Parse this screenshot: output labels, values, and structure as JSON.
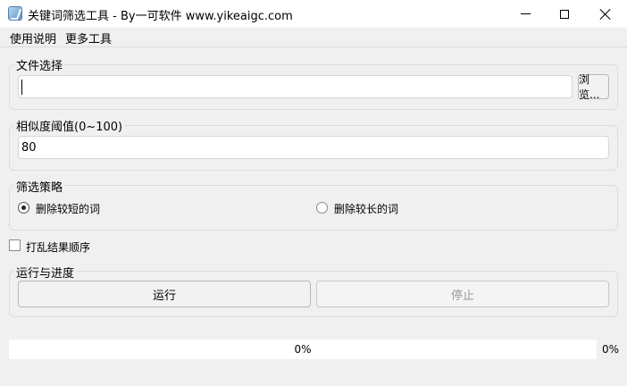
{
  "window": {
    "title": "关键词筛选工具 - By一可软件 www.yikeaigc.com",
    "icon": "app-icon"
  },
  "menu": {
    "items": [
      {
        "label": "使用说明"
      },
      {
        "label": "更多工具"
      }
    ]
  },
  "file_group": {
    "title": "文件选择",
    "path_value": "",
    "browse_label": "浏览..."
  },
  "similarity_group": {
    "title": "相似度阈值(0~100)",
    "value": "80"
  },
  "strategy_group": {
    "title": "筛选策略",
    "options": [
      {
        "label": "删除较短的词",
        "selected": true
      },
      {
        "label": "删除较长的词",
        "selected": false
      }
    ]
  },
  "shuffle_option": {
    "label": "打乱结果顺序",
    "checked": false
  },
  "run_group": {
    "title": "运行与进度",
    "run_label": "运行",
    "stop_label": "停止",
    "stop_enabled": false
  },
  "progress": {
    "value": 0,
    "bar_text": "0%",
    "side_text": "0%",
    "fill_color": "#06b025"
  }
}
